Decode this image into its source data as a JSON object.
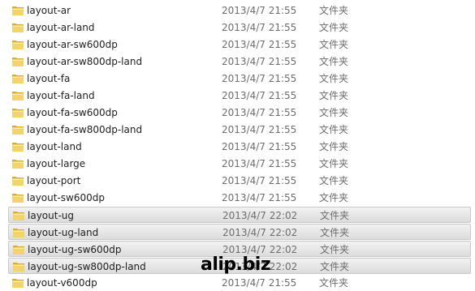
{
  "files": [
    {
      "name": "layout-ar",
      "modified": "2013/4/7 21:55",
      "type": "文件夹",
      "selected": false
    },
    {
      "name": "layout-ar-land",
      "modified": "2013/4/7 21:55",
      "type": "文件夹",
      "selected": false
    },
    {
      "name": "layout-ar-sw600dp",
      "modified": "2013/4/7 21:55",
      "type": "文件夹",
      "selected": false
    },
    {
      "name": "layout-ar-sw800dp-land",
      "modified": "2013/4/7 21:55",
      "type": "文件夹",
      "selected": false
    },
    {
      "name": "layout-fa",
      "modified": "2013/4/7 21:55",
      "type": "文件夹",
      "selected": false
    },
    {
      "name": "layout-fa-land",
      "modified": "2013/4/7 21:55",
      "type": "文件夹",
      "selected": false
    },
    {
      "name": "layout-fa-sw600dp",
      "modified": "2013/4/7 21:55",
      "type": "文件夹",
      "selected": false
    },
    {
      "name": "layout-fa-sw800dp-land",
      "modified": "2013/4/7 21:55",
      "type": "文件夹",
      "selected": false
    },
    {
      "name": "layout-land",
      "modified": "2013/4/7 21:55",
      "type": "文件夹",
      "selected": false
    },
    {
      "name": "layout-large",
      "modified": "2013/4/7 21:55",
      "type": "文件夹",
      "selected": false
    },
    {
      "name": "layout-port",
      "modified": "2013/4/7 21:55",
      "type": "文件夹",
      "selected": false
    },
    {
      "name": "layout-sw600dp",
      "modified": "2013/4/7 21:55",
      "type": "文件夹",
      "selected": false
    },
    {
      "name": "layout-ug",
      "modified": "2013/4/7 22:02",
      "type": "文件夹",
      "selected": true
    },
    {
      "name": "layout-ug-land",
      "modified": "2013/4/7 22:02",
      "type": "文件夹",
      "selected": true
    },
    {
      "name": "layout-ug-sw600dp",
      "modified": "2013/4/7 22:02",
      "type": "文件夹",
      "selected": true
    },
    {
      "name": "layout-ug-sw800dp-land",
      "modified": "2013/4/7 22:02",
      "type": "文件夹",
      "selected": true
    },
    {
      "name": "layout-v600dp",
      "modified": "2013/4/7 21:55",
      "type": "文件夹",
      "selected": false
    }
  ],
  "watermark": {
    "text": "alip.biz"
  },
  "colors": {
    "folder_fill": "#f3d36b",
    "folder_dark": "#d9a93a",
    "selected_bg": "#e4e4e4",
    "selected_border": "#c9c9c9"
  },
  "icons": {
    "folder": "folder-icon"
  }
}
